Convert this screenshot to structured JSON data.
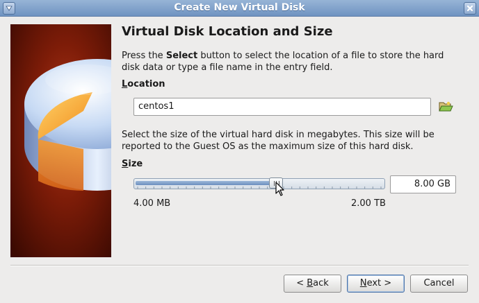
{
  "window": {
    "title": "Create New Virtual Disk"
  },
  "page": {
    "heading": "Virtual Disk Location and Size",
    "intro_before": "Press the ",
    "intro_bold": "Select",
    "intro_after": " button to select the location of a file to store the hard disk data or type a file name in the entry field."
  },
  "location": {
    "label_accel": "L",
    "label_rest": "ocation",
    "value": "centos1"
  },
  "size": {
    "description": "Select the size of the virtual hard disk in megabytes. This size will be reported to the Guest OS as the maximum size of this hard disk.",
    "label_accel": "S",
    "label_rest": "ize",
    "value": "8.00 GB",
    "slider_fraction": 0.57,
    "min_label": "4.00 MB",
    "max_label": "2.00 TB"
  },
  "buttons": {
    "back_prefix": "< ",
    "back_accel": "B",
    "back_rest": "ack",
    "next_accel": "N",
    "next_rest": "ext >",
    "cancel": "Cancel"
  },
  "colors": {
    "titlebar": "#7f9fca",
    "image_background": "#7a1a08",
    "disk_top": "#cfe0f7",
    "disk_slice": "#f7a52a"
  },
  "icons": [
    "window-menu-icon",
    "close-icon",
    "disk-image",
    "folder-open-icon",
    "mouse-cursor-icon"
  ]
}
